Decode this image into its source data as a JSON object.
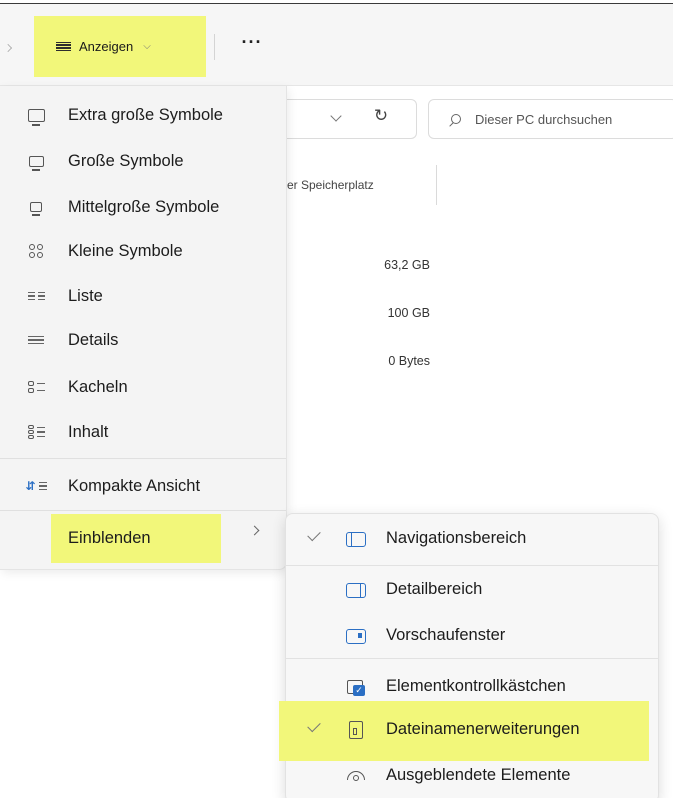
{
  "toolbar": {
    "anzeigen_label": "Anzeigen",
    "more_label": "···"
  },
  "address": {
    "search_placeholder": "Dieser PC durchsuchen",
    "partial_label": "er Speicherplatz"
  },
  "drive_sizes": [
    "63,2 GB",
    "100 GB",
    "0 Bytes"
  ],
  "menu": {
    "items": [
      {
        "label": "Extra große Symbole",
        "icon": "monitor-xl-icon"
      },
      {
        "label": "Große Symbole",
        "icon": "monitor-large-icon"
      },
      {
        "label": "Mittelgroße Symbole",
        "icon": "monitor-medium-icon"
      },
      {
        "label": "Kleine Symbole",
        "icon": "small-grid-icon"
      },
      {
        "label": "Liste",
        "icon": "list-icon"
      },
      {
        "label": "Details",
        "icon": "details-icon"
      },
      {
        "label": "Kacheln",
        "icon": "tiles-icon"
      },
      {
        "label": "Inhalt",
        "icon": "content-icon"
      },
      {
        "label": "Kompakte Ansicht",
        "icon": "compact-view-icon"
      },
      {
        "label": "Einblenden",
        "icon": ""
      }
    ]
  },
  "submenu": {
    "items": [
      {
        "label": "Navigationsbereich",
        "checked": true,
        "icon": "navigation-pane-icon"
      },
      {
        "label": "Detailbereich",
        "checked": false,
        "icon": "details-pane-icon"
      },
      {
        "label": "Vorschaufenster",
        "checked": false,
        "icon": "preview-pane-icon"
      },
      {
        "label": "Elementkontrollkästchen",
        "checked": false,
        "icon": "item-checkbox-icon"
      },
      {
        "label": "Dateinamenerweiterungen",
        "checked": true,
        "icon": "file-extension-icon"
      },
      {
        "label": "Ausgeblendete Elemente",
        "checked": false,
        "icon": "eye-icon"
      }
    ]
  },
  "colors": {
    "highlight": "#f2f77a",
    "accent": "#2b6fc4"
  }
}
